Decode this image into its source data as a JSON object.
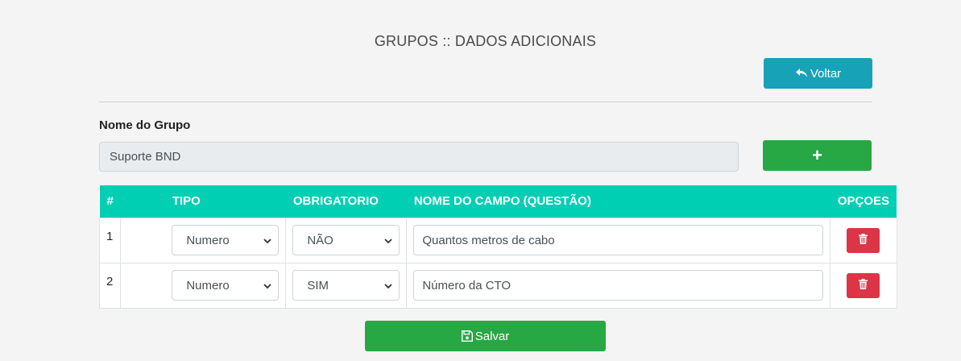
{
  "page": {
    "title": "GRUPOS :: DADOS ADICIONAIS"
  },
  "toolbar": {
    "back_label": "Voltar",
    "add_label": "+",
    "save_label": "Salvar"
  },
  "group": {
    "label": "Nome do Grupo",
    "value": "Suporte BND"
  },
  "table": {
    "columns": [
      "#",
      "TIPO",
      "OBRIGATORIO",
      "NOME DO CAMPO (QUESTÃO)",
      "OPÇOES"
    ],
    "rows": [
      {
        "num": "1",
        "tipo": "Numero",
        "obrigatorio": "NÃO",
        "nome": "Quantos metros de cabo"
      },
      {
        "num": "2",
        "tipo": "Numero",
        "obrigatorio": "SIM",
        "nome": "Número da CTO"
      }
    ]
  },
  "icons": {
    "back": "undo-arrow-icon",
    "add": "plus-icon",
    "delete": "trash-icon",
    "save": "floppy-disk-icon",
    "select": "chevron-down-icon"
  },
  "colors": {
    "info": "#17a2b8",
    "success": "#28a745",
    "danger": "#dc3545",
    "table_header": "#00cfb4"
  }
}
